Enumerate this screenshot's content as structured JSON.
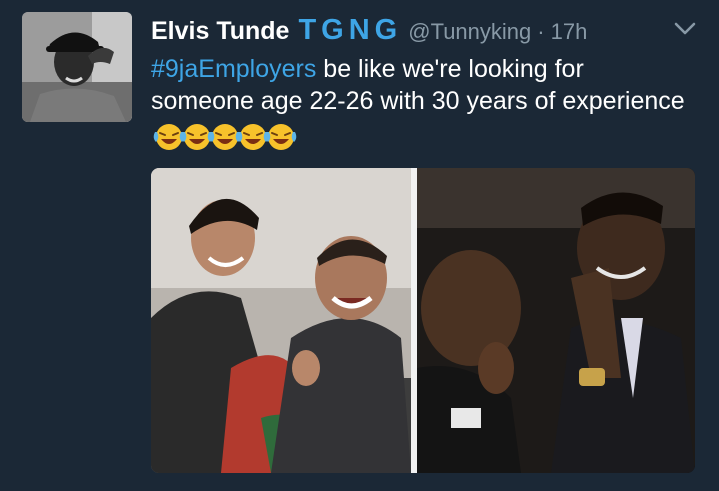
{
  "tweet": {
    "author_name": "Elvis Tunde",
    "author_tag": "TGNG",
    "handle": "@Tunnyking",
    "separator": "·",
    "time": "17h",
    "hashtag": "#9jaEmployers",
    "body": " be like we're looking for someone age 22-26 with 30 years of experience",
    "emoji": "face-with-tears-of-joy",
    "emoji_count": 5
  },
  "icons": {
    "menu": "chevron-down-icon",
    "avatar": "profile-photo"
  },
  "colors": {
    "background": "#1b2836",
    "accent": "#3ea5e6",
    "muted": "#8899a6",
    "text": "#ffffff"
  },
  "media": {
    "panels": 2,
    "description_icon": "photo-collage"
  }
}
